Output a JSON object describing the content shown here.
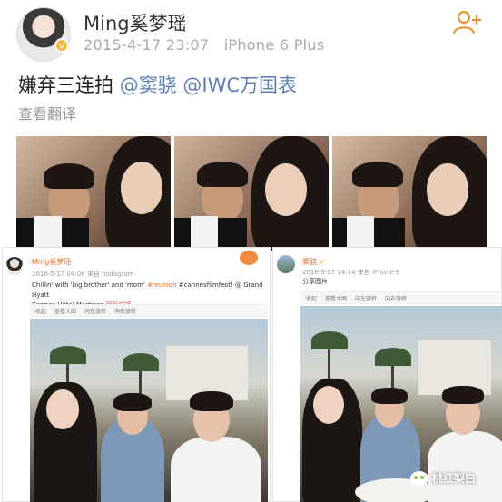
{
  "top_post": {
    "username": "Ming奚梦瑶",
    "timestamp": "2015-4-17 23:07",
    "device": "iPhone 6 Plus",
    "text_prefix": "嫌弃三连拍 ",
    "mention1": "@窦骁",
    "mention2": "@IWC万国表",
    "translate_label": "查看翻译",
    "follow_icon": "add-user-icon",
    "verified_icon": "verified-badge-icon"
  },
  "left_card": {
    "username": "Ming奚梦瑶",
    "meta": "2016-5-17 04:08 来自 Instagram",
    "text1": "Chillin' with 'big brother' and 'mom' ",
    "tag1": "#reunion",
    "text2": " #cannesfilmfest! @ Grand Hyatt",
    "text3": "Cannes Hôtel Martinez ",
    "link_label": "网页链接",
    "toolbar": [
      "收起",
      "查看大图",
      "向左旋转",
      "向右旋转"
    ]
  },
  "right_card": {
    "username": "窦骁",
    "meta": "2016-5-17 14:14 来自 iPhone 6",
    "text": "分享图片",
    "toolbar": [
      "收起",
      "查看大图",
      "向左旋转",
      "向右旋转"
    ]
  },
  "watermark": "桃红梨白",
  "colors": {
    "accent": "#f08a1e",
    "mention": "#5b7cb5",
    "meta": "#aaaaaa"
  }
}
